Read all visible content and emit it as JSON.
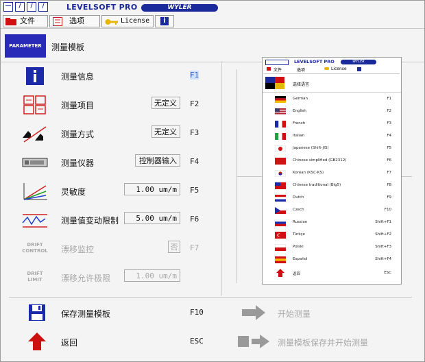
{
  "app": {
    "logo_glyphs": [
      "—",
      "/",
      "/",
      "/"
    ],
    "title": "LEVELSOFT PRO",
    "brand": "WYLER"
  },
  "menu": {
    "file": "文件",
    "options": "选项",
    "license": "License",
    "info": "i"
  },
  "header": {
    "badge": "PARAMETER",
    "title": "测量模板"
  },
  "rows": [
    {
      "label": "测量信息",
      "value": "",
      "fkey": "F1",
      "icon": "info-icon"
    },
    {
      "label": "测量项目",
      "value": "无定义",
      "fkey": "F2",
      "icon": "measure-item-icon"
    },
    {
      "label": "测量方式",
      "value": "无定义",
      "fkey": "F3",
      "icon": "measure-method-icon"
    },
    {
      "label": "测量仪器",
      "value": "控制器输入",
      "fkey": "F4",
      "icon": "instrument-icon"
    },
    {
      "label": "灵敏度",
      "value": "1.00 um/m",
      "fkey": "F5",
      "icon": "sensitivity-icon"
    },
    {
      "label": "测量值变动限制",
      "value": "5.00 um/m",
      "fkey": "F6",
      "icon": "limit-icon"
    },
    {
      "label": "漂移监控",
      "value": "否",
      "fkey": "F7",
      "icon": "drift-control-icon",
      "badge": "DRIFT\nCONTROL"
    },
    {
      "label": "漂移允许极限",
      "value": "1.00 um/m",
      "fkey": "",
      "icon": "drift-limit-icon",
      "badge": "DRIFT\nLIMIT"
    }
  ],
  "bottom": {
    "save_label": "保存测量模板",
    "save_key": "F10",
    "back_label": "返回",
    "back_key": "ESC",
    "start_label": "开始测量",
    "save_start_label": "测量模板保存并开始测量"
  },
  "inner": {
    "title": "LEVELSOFT PRO",
    "brand": "WYLER",
    "menu_file": "文件",
    "menu_options": "选项",
    "menu_license": "License",
    "header": "选择语言",
    "languages": [
      {
        "name": "German",
        "key": "F1",
        "flag": "de"
      },
      {
        "name": "English",
        "key": "F2",
        "flag": "us"
      },
      {
        "name": "French",
        "key": "F3",
        "flag": "fr"
      },
      {
        "name": "Italian",
        "key": "F4",
        "flag": "it"
      },
      {
        "name": "Japanese (Shift-JIS)",
        "key": "F5",
        "flag": "jp"
      },
      {
        "name": "Chinese simplified (GB2312)",
        "key": "F6",
        "flag": "cn"
      },
      {
        "name": "Korean (KSC-KS)",
        "key": "F7",
        "flag": "kr"
      },
      {
        "name": "Chinese traditional (Big5)",
        "key": "F8",
        "flag": "tw"
      },
      {
        "name": "Dutch",
        "key": "F9",
        "flag": "nl"
      },
      {
        "name": "Czech",
        "key": "F10",
        "flag": "cz"
      },
      {
        "name": "Russian",
        "key": "Shift+F1",
        "flag": "ru"
      },
      {
        "name": "Türkçe",
        "key": "Shift+F2",
        "flag": "tr"
      },
      {
        "name": "Polski",
        "key": "Shift+F3",
        "flag": "pl"
      },
      {
        "name": "Español",
        "key": "Shift+F4",
        "flag": "es"
      }
    ],
    "back_label": "返回",
    "back_key": "ESC"
  },
  "colors": {
    "brand_blue": "#1a2a9a",
    "badge_blue": "#2a2ab8",
    "back_red": "#cc1010",
    "disabled": "#a8a8a8"
  }
}
